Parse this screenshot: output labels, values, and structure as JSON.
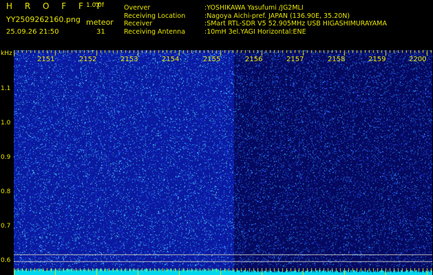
{
  "header": {
    "app_title": "H R O F F T",
    "version": "1.0.0f",
    "filename": "YY2509262160.png",
    "datetime": "25.09.26 21:50",
    "meteor_label": "meteor",
    "meteor_count": "31"
  },
  "station_info": [
    {
      "key": "Overver",
      "value": ":YOSHIKAWA Yasufumi /JG2MLI"
    },
    {
      "key": "Receiving Location",
      "value": ":Nagoya Aichi-pref. JAPAN (136.90E, 35.20N)"
    },
    {
      "key": "Receiver",
      "value": ":SMart RTL-SDR V5 52.905MHz USB HIGASHIMURAYAMA"
    },
    {
      "key": "Receiving Antenna",
      "value": ":10mH 3el.YAGI Horizontal:ENE"
    }
  ],
  "spectrogram": {
    "y_unit": "kHz",
    "y_ticks": [
      "1.1",
      "1.0",
      "0.9",
      "0.8",
      "0.7",
      "0.6"
    ],
    "x_ticks": [
      "2151",
      "2152",
      "2153",
      "2154",
      "2155",
      "2156",
      "2157",
      "2158",
      "2159",
      "2200"
    ],
    "x_range": [
      2150,
      2200
    ],
    "y_range": [
      0.56,
      1.18
    ],
    "colors": {
      "dense_background": "#0a1aa0",
      "sparse_background": "#050a60",
      "speckle": "#3ad0ff",
      "bottom_band": "#00d8f0",
      "tick_marks": "#e8e600",
      "ref_lines": "#c0c0c0"
    }
  }
}
